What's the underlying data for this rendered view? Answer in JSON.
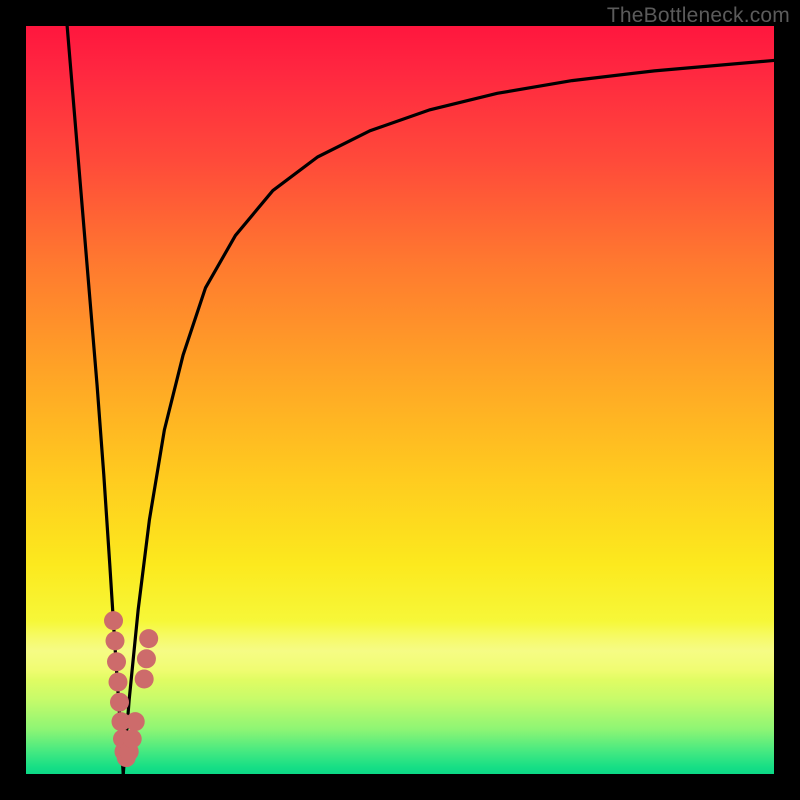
{
  "watermark": "TheBottleneck.com",
  "colors": {
    "frame": "#000000",
    "curve": "#000000",
    "dots": "#cd6b6b",
    "watermark": "#5b5b5b"
  },
  "chart_data": {
    "type": "line",
    "title": "",
    "xlabel": "",
    "ylabel": "",
    "xlim": [
      0,
      100
    ],
    "ylim": [
      0,
      100
    ],
    "axes_visible": false,
    "gradient_stops": [
      {
        "pct": 0,
        "color": "#ff163e"
      },
      {
        "pct": 18,
        "color": "#ff4a3a"
      },
      {
        "pct": 46,
        "color": "#ffa326"
      },
      {
        "pct": 72,
        "color": "#fce91e"
      },
      {
        "pct": 90,
        "color": "#c7fb6a"
      },
      {
        "pct": 100,
        "color": "#0bd986"
      }
    ],
    "series": [
      {
        "name": "left-branch",
        "x": [
          5.5,
          6.5,
          7.5,
          8.5,
          9.5,
          10.4,
          11.2,
          11.9,
          12.5,
          13.0
        ],
        "y": [
          100,
          88,
          76,
          64,
          52,
          40,
          28,
          17,
          8,
          0
        ]
      },
      {
        "name": "right-branch",
        "x": [
          13.0,
          13.8,
          15.0,
          16.5,
          18.5,
          21.0,
          24.0,
          28.0,
          33.0,
          39.0,
          46.0,
          54.0,
          63.0,
          73.0,
          84.0,
          100.0
        ],
        "y": [
          0,
          10,
          22,
          34,
          46,
          56,
          65,
          72,
          78,
          82.5,
          86,
          88.8,
          91,
          92.7,
          94,
          95.4
        ]
      }
    ],
    "points": [
      {
        "x": 11.7,
        "y": 20.5
      },
      {
        "x": 11.9,
        "y": 17.8
      },
      {
        "x": 12.1,
        "y": 15.0
      },
      {
        "x": 12.3,
        "y": 12.3
      },
      {
        "x": 12.5,
        "y": 9.6
      },
      {
        "x": 12.7,
        "y": 7.0
      },
      {
        "x": 12.9,
        "y": 4.7
      },
      {
        "x": 13.1,
        "y": 3.0
      },
      {
        "x": 13.4,
        "y": 2.2
      },
      {
        "x": 13.8,
        "y": 3.0
      },
      {
        "x": 14.2,
        "y": 4.7
      },
      {
        "x": 14.6,
        "y": 7.0
      },
      {
        "x": 15.8,
        "y": 12.7
      },
      {
        "x": 16.1,
        "y": 15.4
      },
      {
        "x": 16.4,
        "y": 18.1
      }
    ],
    "annotations": [
      {
        "text": "TheBottleneck.com",
        "position": "top-right"
      }
    ]
  }
}
